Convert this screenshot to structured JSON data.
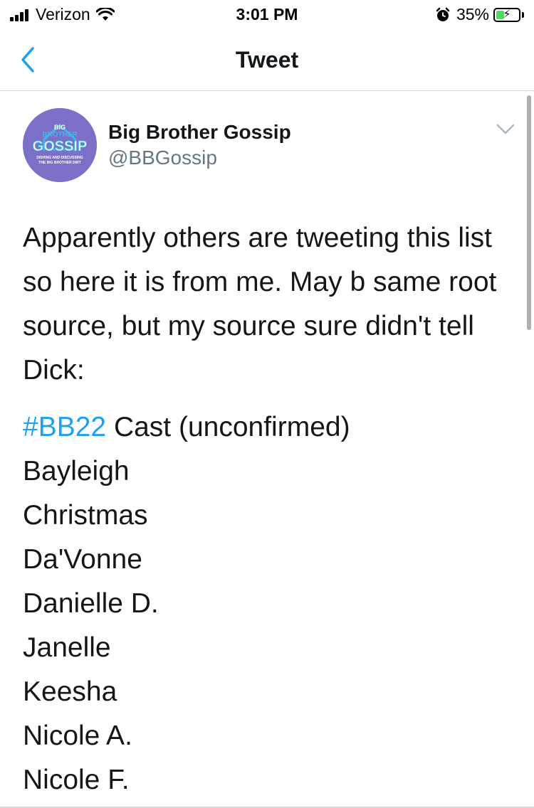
{
  "status_bar": {
    "carrier": "Verizon",
    "time": "3:01 PM",
    "battery_percent": "35%",
    "battery_level": 0.35,
    "icons": [
      "signal-icon",
      "wifi-icon",
      "alarm-icon",
      "battery-icon",
      "charging-bolt-icon"
    ]
  },
  "nav": {
    "title": "Tweet",
    "back_icon": "chevron-left-icon"
  },
  "tweet": {
    "avatar": {
      "line1": "BIG",
      "line2": "BROTHER",
      "line3": "GOSSIP",
      "line4": "DISHING AND DISCUSSING",
      "line5": "THE BIG BROTHER DIRT"
    },
    "display_name": "Big Brother Gossip",
    "handle": "@BBGossip",
    "more_icon": "chevron-down-icon",
    "text": "Apparently others are tweeting this list so here it is from me. May b same root source, but my source sure didn't tell Dick:",
    "hashtag": "#BB22",
    "cast_heading": " Cast (unconfirmed)",
    "cast": [
      "Bayleigh",
      "Christmas",
      "Da'Vonne",
      "Danielle D.",
      "Janelle",
      "Keesha",
      "Nicole A.",
      "Nicole F."
    ],
    "colors": {
      "hashtag": "#1da1f2",
      "back_arrow": "#1da1f2",
      "handle": "#657786",
      "avatar_bg": "#7b6fc8"
    }
  }
}
